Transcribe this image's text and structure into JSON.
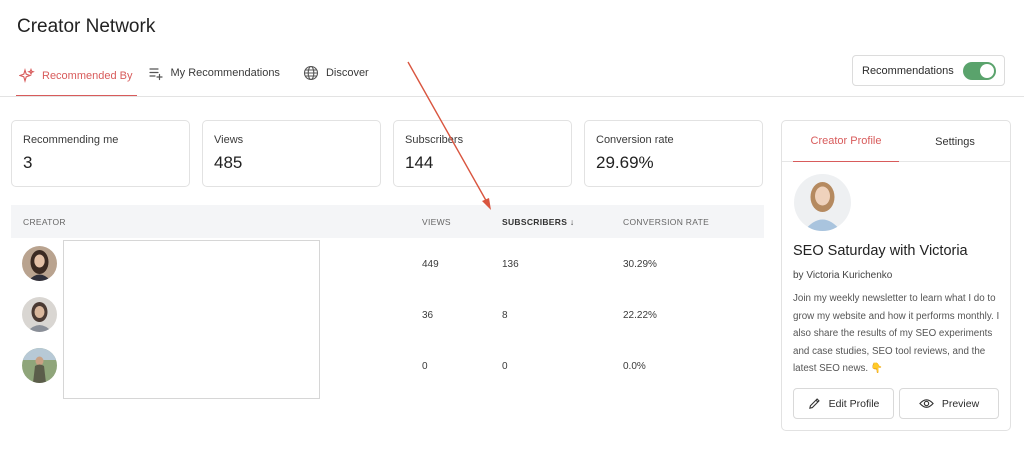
{
  "page": {
    "title": "Creator Network"
  },
  "tabs": [
    {
      "label": "Recommended By",
      "icon": "sparkle-icon",
      "active": true
    },
    {
      "label": "My Recommendations",
      "icon": "list-add-icon",
      "active": false
    },
    {
      "label": "Discover",
      "icon": "globe-icon",
      "active": false
    }
  ],
  "recommendations_toggle": {
    "label": "Recommendations",
    "enabled": true,
    "color": "#5aa36c"
  },
  "stats": [
    {
      "label": "Recommending me",
      "value": "3"
    },
    {
      "label": "Views",
      "value": "485"
    },
    {
      "label": "Subscribers",
      "value": "144"
    },
    {
      "label": "Conversion rate",
      "value": "29.69%"
    }
  ],
  "table": {
    "headers": {
      "creator": "CREATOR",
      "views": "VIEWS",
      "subscribers": "SUBSCRIBERS ↓",
      "conversion": "CONVERSION RATE"
    },
    "rows": [
      {
        "views": "449",
        "subscribers": "136",
        "conversion": "30.29%"
      },
      {
        "views": "36",
        "subscribers": "8",
        "conversion": "22.22%"
      },
      {
        "views": "0",
        "subscribers": "0",
        "conversion": "0.0%"
      }
    ]
  },
  "sidebar": {
    "tabs": [
      {
        "label": "Creator Profile",
        "active": true
      },
      {
        "label": "Settings",
        "active": false
      }
    ],
    "profile": {
      "name": "SEO Saturday with Victoria",
      "by": "by Victoria Kurichenko",
      "bio": "Join my weekly newsletter to learn what I do to grow my website and how it performs monthly. I also share the results of my SEO experiments and case studies, SEO tool reviews, and the latest SEO news. 👇"
    },
    "buttons": {
      "edit": "Edit Profile",
      "preview": "Preview"
    }
  },
  "colors": {
    "accent": "#d85b5b",
    "annotation_arrow": "#d9553f"
  }
}
